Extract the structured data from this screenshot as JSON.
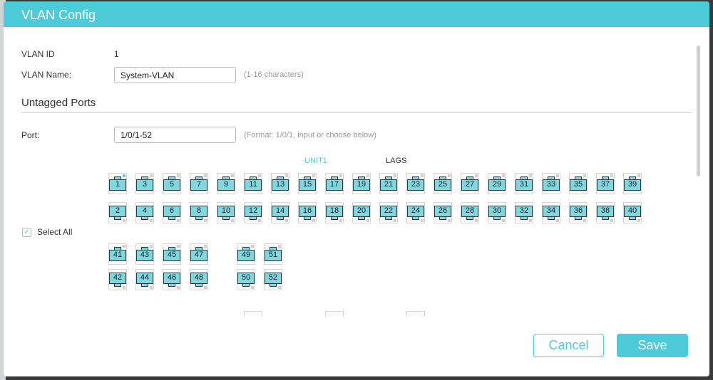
{
  "dialog": {
    "title": "VLAN Config",
    "vlan_id_label": "VLAN ID",
    "vlan_id_value": "1",
    "vlan_name_label": "VLAN Name:",
    "vlan_name_value": "System-VLAN",
    "vlan_name_hint": "(1-16 characters)",
    "untagged_title": "Untagged Ports",
    "port_label": "Port:",
    "port_value": "1/0/1-52",
    "port_hint": "(Format: 1/0/1, input or choose below)",
    "unit_label": "UNIT1",
    "lags_label": "LAGS",
    "select_all_label": "Select All",
    "cancel_label": "Cancel",
    "save_label": "Save"
  },
  "colors": {
    "accent": "#4ecbd8",
    "port_fill": "#7fd7e0"
  },
  "ports": {
    "row1": [
      "1",
      "3",
      "5",
      "7",
      "9",
      "11",
      "13",
      "15",
      "17",
      "19",
      "21",
      "23",
      "25",
      "27",
      "29",
      "31",
      "33",
      "35",
      "37",
      "39"
    ],
    "row2": [
      "2",
      "4",
      "6",
      "8",
      "10",
      "12",
      "14",
      "16",
      "18",
      "20",
      "22",
      "24",
      "26",
      "28",
      "30",
      "32",
      "34",
      "36",
      "38",
      "40"
    ],
    "row3_left": [
      "41",
      "43",
      "45",
      "47"
    ],
    "row3_right": [
      "49",
      "51"
    ],
    "row4_left": [
      "42",
      "44",
      "46",
      "48"
    ],
    "row4_right": [
      "50",
      "52"
    ],
    "active_led_port": "1"
  },
  "icons": {
    "checkbox": "check-icon"
  }
}
